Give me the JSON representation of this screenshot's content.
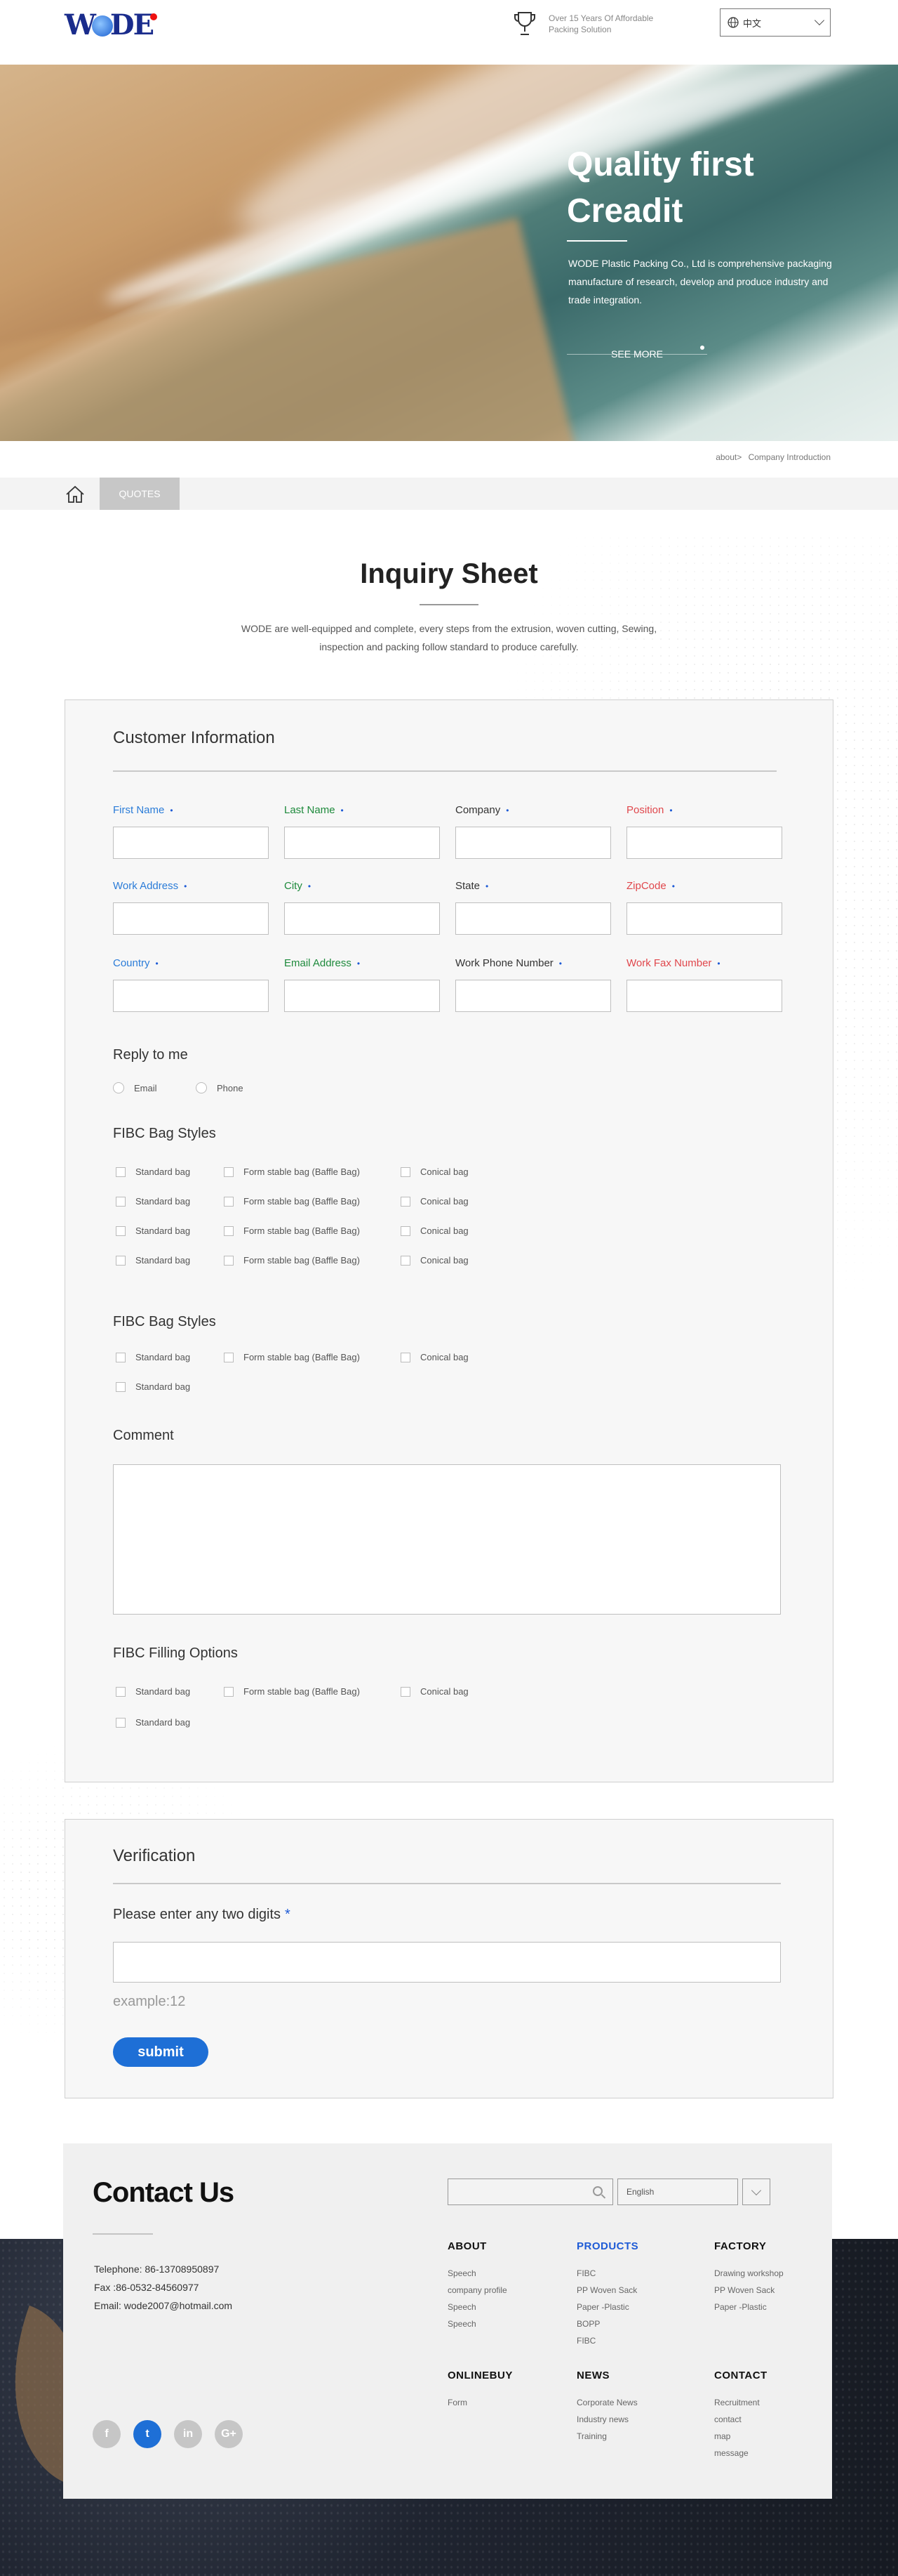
{
  "header": {
    "logo_text": "WODE",
    "tagline_line1": "Over 15 Years Of Affordable",
    "tagline_line2": "Packing Solution",
    "language": "中文"
  },
  "hero": {
    "title_line1": "Quality first",
    "title_line2": "Creadit",
    "description": "WODE Plastic Packing Co., Ltd is comprehensive packaging manufacture of research, develop and produce industry and trade integration.",
    "button": "SEE MORE"
  },
  "breadcrumb": {
    "parent": "about>",
    "current": "Company Introduction"
  },
  "subnav": {
    "tab": "QUOTES"
  },
  "page": {
    "title": "Inquiry Sheet",
    "intro": "WODE are well-equipped and complete, every steps from the extrusion, woven cutting, Sewing, inspection and packing follow standard to produce carefully."
  },
  "customer": {
    "title": "Customer Information",
    "fields": [
      {
        "label": "First Name",
        "req": "•"
      },
      {
        "label": "Last Name",
        "req": "•"
      },
      {
        "label": "Company",
        "req": "•"
      },
      {
        "label": "Position",
        "req": "•"
      },
      {
        "label": "Work Address",
        "req": "•"
      },
      {
        "label": "City",
        "req": "•"
      },
      {
        "label": "State",
        "req": "•"
      },
      {
        "label": "ZipCode",
        "req": "•"
      },
      {
        "label": "Country",
        "req": "•"
      },
      {
        "label": "Email Address",
        "req": "•"
      },
      {
        "label": "Work Phone Number",
        "req": "•"
      },
      {
        "label": "Work Fax Number",
        "req": "•"
      }
    ],
    "reply": {
      "title": "Reply to me",
      "options": [
        "Email",
        "Phone"
      ]
    },
    "styles1": {
      "title": "FIBC Bag Styles",
      "col1": [
        "Standard bag",
        "Standard bag",
        "Standard bag",
        "Standard bag"
      ],
      "col2": [
        "Form stable bag (Baffle Bag)",
        "Form stable bag (Baffle Bag)",
        "Form stable bag (Baffle Bag)",
        "Form stable bag (Baffle Bag)"
      ],
      "col3": [
        "Conical bag",
        "Conical bag",
        "Conical bag",
        "Conical bag"
      ]
    },
    "styles2": {
      "title": "FIBC Bag Styles",
      "items": [
        "Standard bag",
        "Form stable bag (Baffle Bag)",
        "Conical bag",
        "Standard bag"
      ]
    },
    "comment": {
      "title": "Comment"
    },
    "filling": {
      "title": "FIBC Filling Options",
      "items": [
        "Standard bag",
        "Form stable bag (Baffle Bag)",
        "Conical bag",
        "Standard bag"
      ]
    }
  },
  "verification": {
    "title": "Verification",
    "label": "Please enter any two digits",
    "star": "*",
    "hint": "example:12",
    "submit": "submit"
  },
  "footer": {
    "title": "Contact Us",
    "telephone": "Telephone: 86-13708950897",
    "fax": "Fax :86-0532-84560977",
    "email": "Email: wode2007@hotmail.com",
    "language": "English",
    "socials": [
      "f",
      "t",
      "in",
      "G+"
    ],
    "columns": [
      {
        "title": "ABOUT",
        "items": [
          "Speech",
          "company profile",
          "Speech",
          "Speech"
        ]
      },
      {
        "title": "PRODUCTS",
        "items": [
          "FIBC",
          "PP Woven Sack",
          "Paper -Plastic",
          "BOPP",
          "FIBC"
        ]
      },
      {
        "title": "FACTORY",
        "items": [
          "Drawing workshop",
          "PP Woven Sack",
          "Paper -Plastic"
        ]
      },
      {
        "title": "ONLINEBUY",
        "items": [
          "Form"
        ]
      },
      {
        "title": "NEWS",
        "items": [
          "Corporate News",
          "Industry news",
          "Training"
        ]
      },
      {
        "title": "CONTACT",
        "items": [
          "Recruitment",
          "contact",
          "map",
          "message"
        ]
      }
    ]
  }
}
